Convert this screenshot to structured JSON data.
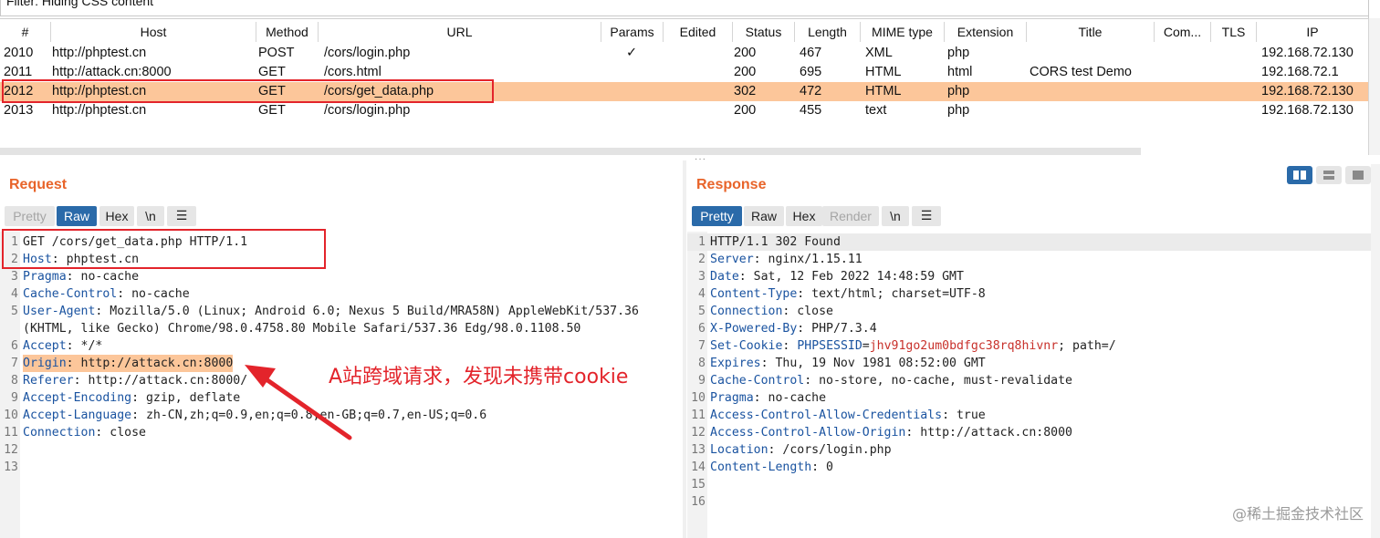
{
  "filter": {
    "text": "Filter: Hiding CSS content"
  },
  "table": {
    "columns": [
      "#",
      "Host",
      "Method",
      "URL",
      "Params",
      "Edited",
      "Status",
      "Length",
      "MIME type",
      "Extension",
      "Title",
      "Com...",
      "TLS",
      "IP"
    ],
    "rows": [
      {
        "id": "2010",
        "host": "http://phptest.cn",
        "method": "POST",
        "url": "/cors/login.php",
        "params": "✓",
        "status": "200",
        "length": "467",
        "mime": "XML",
        "ext": "php",
        "title": "",
        "ip": "192.168.72.130"
      },
      {
        "id": "2011",
        "host": "http://attack.cn:8000",
        "method": "GET",
        "url": "/cors.html",
        "params": "",
        "status": "200",
        "length": "695",
        "mime": "HTML",
        "ext": "html",
        "title": "CORS test Demo",
        "ip": "192.168.72.1"
      },
      {
        "id": "2012",
        "host": "http://phptest.cn",
        "method": "GET",
        "url": "/cors/get_data.php",
        "params": "",
        "status": "302",
        "length": "472",
        "mime": "HTML",
        "ext": "php",
        "title": "",
        "ip": "192.168.72.130"
      },
      {
        "id": "2013",
        "host": "http://phptest.cn",
        "method": "GET",
        "url": "/cors/login.php",
        "params": "",
        "status": "200",
        "length": "455",
        "mime": "text",
        "ext": "php",
        "title": "",
        "ip": "192.168.72.130"
      }
    ]
  },
  "request": {
    "title": "Request",
    "tabs": [
      "Pretty",
      "Raw",
      "Hex",
      "\\n",
      "☰"
    ],
    "lines": [
      {
        "n": "1",
        "name": "",
        "value": "GET /cors/get_data.php HTTP/1.1"
      },
      {
        "n": "2",
        "name": "Host",
        "value": " phptest.cn"
      },
      {
        "n": "3",
        "name": "Pragma",
        "value": " no-cache"
      },
      {
        "n": "4",
        "name": "Cache-Control",
        "value": " no-cache"
      },
      {
        "n": "5",
        "name": "User-Agent",
        "value": " Mozilla/5.0 (Linux; Android 6.0; Nexus 5 Build/MRA58N) AppleWebKit/537.36"
      },
      {
        "n": "",
        "name": "",
        "value": "(KHTML, like Gecko) Chrome/98.0.4758.80 Mobile Safari/537.36 Edg/98.0.1108.50"
      },
      {
        "n": "6",
        "name": "Accept",
        "value": " */*"
      },
      {
        "n": "7",
        "name": "Origin",
        "value": " http://attack.cn:8000"
      },
      {
        "n": "8",
        "name": "Referer",
        "value": " http://attack.cn:8000/"
      },
      {
        "n": "9",
        "name": "Accept-Encoding",
        "value": " gzip, deflate"
      },
      {
        "n": "10",
        "name": "Accept-Language",
        "value": " zh-CN,zh;q=0.9,en;q=0.8,en-GB;q=0.7,en-US;q=0.6"
      },
      {
        "n": "11",
        "name": "Connection",
        "value": " close"
      },
      {
        "n": "12",
        "name": "",
        "value": ""
      },
      {
        "n": "13",
        "name": "",
        "value": ""
      }
    ]
  },
  "response": {
    "title": "Response",
    "tabs": [
      "Pretty",
      "Raw",
      "Hex",
      "Render",
      "\\n",
      "☰"
    ],
    "lines": [
      {
        "n": "1",
        "name": "",
        "value": "HTTP/1.1 302 Found"
      },
      {
        "n": "2",
        "name": "Server",
        "value": " nginx/1.15.11"
      },
      {
        "n": "3",
        "name": "Date",
        "value": " Sat, 12 Feb 2022 14:48:59 GMT"
      },
      {
        "n": "4",
        "name": "Content-Type",
        "value": " text/html; charset=UTF-8"
      },
      {
        "n": "5",
        "name": "Connection",
        "value": " close"
      },
      {
        "n": "6",
        "name": "X-Powered-By",
        "value": " PHP/7.3.4"
      },
      {
        "n": "7",
        "name": "Set-Cookie",
        "value": " "
      },
      {
        "n": "8",
        "name": "Expires",
        "value": " Thu, 19 Nov 1981 08:52:00 GMT"
      },
      {
        "n": "9",
        "name": "Cache-Control",
        "value": " no-store, no-cache, must-revalidate"
      },
      {
        "n": "10",
        "name": "Pragma",
        "value": " no-cache"
      },
      {
        "n": "11",
        "name": "Access-Control-Allow-Credentials",
        "value": " true"
      },
      {
        "n": "12",
        "name": "Access-Control-Allow-Origin",
        "value": " http://attack.cn:8000"
      },
      {
        "n": "13",
        "name": "Location",
        "value": " /cors/login.php"
      },
      {
        "n": "14",
        "name": "Content-Length",
        "value": " 0"
      },
      {
        "n": "15",
        "name": "",
        "value": ""
      },
      {
        "n": "16",
        "name": "",
        "value": ""
      }
    ],
    "cookie": {
      "name": "PHPSESSID",
      "value": "jhv91go2um0bdfgc38rq8hivnr",
      "rest": "; path=/"
    }
  },
  "annotation": {
    "text": "A站跨域请求，发现未携带cookie"
  },
  "watermark": {
    "text": "@稀土掘金技术社区"
  },
  "colors": {
    "accent": "#e8642a",
    "selected_row": "#fcc69a",
    "tab_active": "#2a6aa9",
    "header_name": "#1a53a0",
    "cookie_value": "#c8312b",
    "annotation": "#e3242b"
  }
}
